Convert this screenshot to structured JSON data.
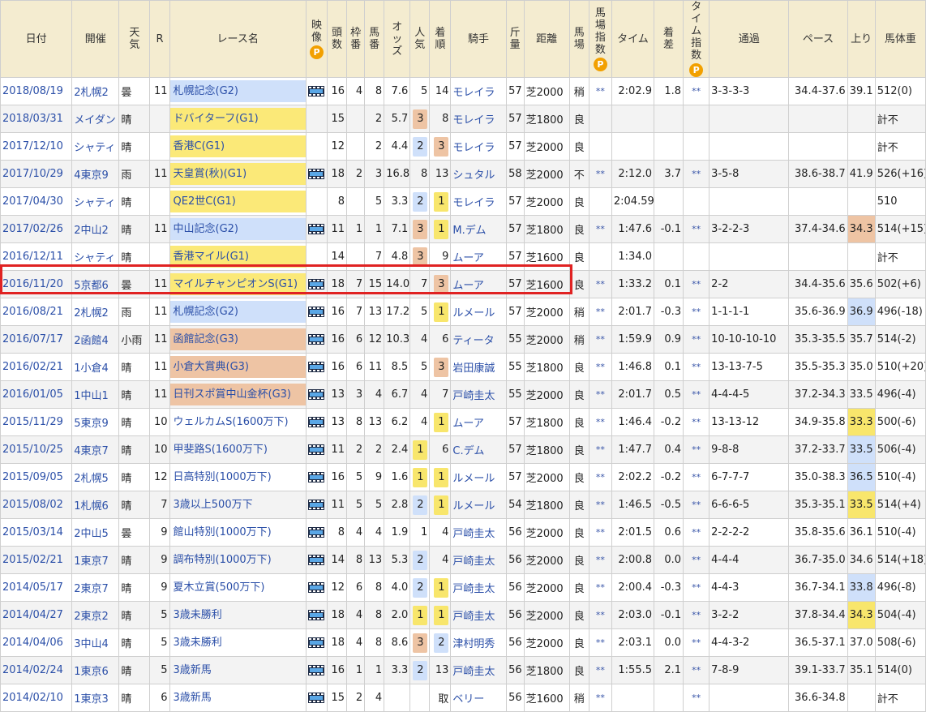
{
  "headers": {
    "date": "日付",
    "venue": "開催",
    "weather": [
      "天",
      "気"
    ],
    "race_no": "R",
    "race_name": "レース名",
    "video": [
      "映",
      "像"
    ],
    "field_size": [
      "頭",
      "数"
    ],
    "frame": [
      "枠",
      "番"
    ],
    "horse_no": [
      "馬",
      "番"
    ],
    "odds": [
      "オ",
      "ッ",
      "ズ"
    ],
    "popularity": [
      "人",
      "気"
    ],
    "finish": [
      "着",
      "順"
    ],
    "jockey": "騎手",
    "weight_carried": [
      "斤",
      "量"
    ],
    "distance": "距離",
    "track": [
      "馬",
      "場"
    ],
    "track_index": [
      "馬",
      "場",
      "指",
      "数"
    ],
    "time": "タイム",
    "margin": [
      "着",
      "差"
    ],
    "time_index": [
      "タ",
      "イ",
      "ム",
      "指",
      "数"
    ],
    "passing": "通過",
    "pace": "ペース",
    "last3f": "上り",
    "body_weight": "馬体重",
    "p_badge": "P"
  },
  "rows": [
    {
      "date": "2018/08/19",
      "venue": "2札幌2",
      "weather": "曇",
      "race_no": "11",
      "race_name": "札幌記念(G2)",
      "grade": "g2",
      "video": true,
      "field_size": "16",
      "frame": "4",
      "horse_no": "8",
      "odds": "7.6",
      "popularity": "5",
      "finish": "14",
      "finish_mark": "",
      "jockey": "モレイラ",
      "weight_carried": "57",
      "distance": "芝2000",
      "track": "稍",
      "track_index": "**",
      "time": "2:02.9",
      "margin": "1.8",
      "time_index": "**",
      "passing": "3-3-3-3",
      "pace": "34.4-37.6",
      "last3f": "39.1",
      "last3f_rank": "",
      "body_weight": "512(0)"
    },
    {
      "date": "2018/03/31",
      "venue": "メイダン",
      "weather": "晴",
      "race_no": "",
      "race_name": "ドバイターフ(G1)",
      "grade": "g1",
      "video": false,
      "field_size": "15",
      "frame": "",
      "horse_no": "2",
      "odds": "5.7",
      "popularity": "3",
      "finish": "8",
      "finish_mark": "",
      "jockey": "モレイラ",
      "weight_carried": "57",
      "distance": "芝1800",
      "track": "良",
      "track_index": "",
      "time": "",
      "margin": "",
      "time_index": "",
      "passing": "",
      "pace": "",
      "last3f": "",
      "last3f_rank": "",
      "body_weight": "計不",
      "pop_mark": "p"
    },
    {
      "date": "2017/12/10",
      "venue": "シャティ",
      "weather": "晴",
      "race_no": "",
      "race_name": "香港C(G1)",
      "grade": "g1",
      "video": false,
      "field_size": "12",
      "frame": "",
      "horse_no": "2",
      "odds": "4.4",
      "popularity": "2",
      "finish": "3",
      "finish_mark": "p",
      "jockey": "モレイラ",
      "weight_carried": "57",
      "distance": "芝2000",
      "track": "良",
      "track_index": "",
      "time": "",
      "margin": "",
      "time_index": "",
      "passing": "",
      "pace": "",
      "last3f": "",
      "last3f_rank": "",
      "body_weight": "計不",
      "pop_mark": "b"
    },
    {
      "date": "2017/10/29",
      "venue": "4東京9",
      "weather": "雨",
      "race_no": "11",
      "race_name": "天皇賞(秋)(G1)",
      "grade": "g1",
      "video": true,
      "field_size": "18",
      "frame": "2",
      "horse_no": "3",
      "odds": "16.8",
      "popularity": "8",
      "finish": "13",
      "finish_mark": "",
      "jockey": "シュタル",
      "weight_carried": "58",
      "distance": "芝2000",
      "track": "不",
      "track_index": "**",
      "time": "2:12.0",
      "margin": "3.7",
      "time_index": "**",
      "passing": "3-5-8",
      "pace": "38.6-38.7",
      "last3f": "41.9",
      "last3f_rank": "",
      "body_weight": "526(+16)"
    },
    {
      "date": "2017/04/30",
      "venue": "シャティ",
      "weather": "晴",
      "race_no": "",
      "race_name": "QE2世C(G1)",
      "grade": "g1",
      "video": false,
      "field_size": "8",
      "frame": "",
      "horse_no": "5",
      "odds": "3.3",
      "popularity": "2",
      "finish": "1",
      "finish_mark": "w",
      "jockey": "モレイラ",
      "weight_carried": "57",
      "distance": "芝2000",
      "track": "良",
      "track_index": "",
      "time": "2:04.59",
      "margin": "",
      "time_index": "",
      "passing": "",
      "pace": "",
      "last3f": "",
      "last3f_rank": "",
      "body_weight": "510",
      "pop_mark": "b"
    },
    {
      "date": "2017/02/26",
      "venue": "2中山2",
      "weather": "晴",
      "race_no": "11",
      "race_name": "中山記念(G2)",
      "grade": "g2",
      "video": true,
      "field_size": "11",
      "frame": "1",
      "horse_no": "1",
      "odds": "7.1",
      "popularity": "3",
      "finish": "1",
      "finish_mark": "w",
      "jockey": "M.デム",
      "weight_carried": "57",
      "distance": "芝1800",
      "track": "良",
      "track_index": "**",
      "time": "1:47.6",
      "margin": "-0.1",
      "time_index": "**",
      "passing": "3-2-2-3",
      "pace": "37.4-34.6",
      "last3f": "34.3",
      "last3f_rank": "fast2",
      "body_weight": "514(+15)",
      "pop_mark": "p"
    },
    {
      "date": "2016/12/11",
      "venue": "シャティ",
      "weather": "晴",
      "race_no": "",
      "race_name": "香港マイル(G1)",
      "grade": "g1",
      "video": false,
      "field_size": "14",
      "frame": "",
      "horse_no": "7",
      "odds": "4.8",
      "popularity": "3",
      "finish": "9",
      "finish_mark": "",
      "jockey": "ムーア",
      "weight_carried": "57",
      "distance": "芝1600",
      "track": "良",
      "track_index": "",
      "time": "1:34.0",
      "margin": "",
      "time_index": "",
      "passing": "",
      "pace": "",
      "last3f": "",
      "last3f_rank": "",
      "body_weight": "計不",
      "pop_mark": "p"
    },
    {
      "date": "2016/11/20",
      "venue": "5京都6",
      "weather": "曇",
      "race_no": "11",
      "race_name": "マイルチャンピオンS(G1)",
      "grade": "g1",
      "video": true,
      "field_size": "18",
      "frame": "7",
      "horse_no": "15",
      "odds": "14.0",
      "popularity": "7",
      "finish": "3",
      "finish_mark": "p",
      "jockey": "ムーア",
      "weight_carried": "57",
      "distance": "芝1600",
      "track": "良",
      "track_index": "**",
      "time": "1:33.2",
      "margin": "0.1",
      "time_index": "**",
      "passing": "2-2",
      "pace": "34.4-35.6",
      "last3f": "35.6",
      "last3f_rank": "",
      "body_weight": "502(+6)"
    },
    {
      "date": "2016/08/21",
      "venue": "2札幌2",
      "weather": "雨",
      "race_no": "11",
      "race_name": "札幌記念(G2)",
      "grade": "g2",
      "video": true,
      "field_size": "16",
      "frame": "7",
      "horse_no": "13",
      "odds": "17.2",
      "popularity": "5",
      "finish": "1",
      "finish_mark": "w",
      "jockey": "ルメール",
      "weight_carried": "57",
      "distance": "芝2000",
      "track": "稍",
      "track_index": "**",
      "time": "2:01.7",
      "margin": "-0.3",
      "time_index": "**",
      "passing": "1-1-1-1",
      "pace": "35.6-36.9",
      "last3f": "36.9",
      "last3f_rank": "fast3",
      "body_weight": "496(-18)"
    },
    {
      "date": "2016/07/17",
      "venue": "2函館4",
      "weather": "小雨",
      "race_no": "11",
      "race_name": "函館記念(G3)",
      "grade": "g3",
      "video": true,
      "field_size": "16",
      "frame": "6",
      "horse_no": "12",
      "odds": "10.3",
      "popularity": "4",
      "finish": "6",
      "finish_mark": "",
      "jockey": "ティータ",
      "weight_carried": "55",
      "distance": "芝2000",
      "track": "稍",
      "track_index": "**",
      "time": "1:59.9",
      "margin": "0.9",
      "time_index": "**",
      "passing": "10-10-10-10",
      "pace": "35.3-35.5",
      "last3f": "35.7",
      "last3f_rank": "",
      "body_weight": "514(-2)"
    },
    {
      "date": "2016/02/21",
      "venue": "1小倉4",
      "weather": "晴",
      "race_no": "11",
      "race_name": "小倉大賞典(G3)",
      "grade": "g3",
      "video": true,
      "field_size": "16",
      "frame": "6",
      "horse_no": "11",
      "odds": "8.5",
      "popularity": "5",
      "finish": "3",
      "finish_mark": "p",
      "jockey": "岩田康誠",
      "weight_carried": "55",
      "distance": "芝1800",
      "track": "良",
      "track_index": "**",
      "time": "1:46.8",
      "margin": "0.1",
      "time_index": "**",
      "passing": "13-13-7-5",
      "pace": "35.5-35.3",
      "last3f": "35.0",
      "last3f_rank": "",
      "body_weight": "510(+20)"
    },
    {
      "date": "2016/01/05",
      "venue": "1中山1",
      "weather": "晴",
      "race_no": "11",
      "race_name": "日刊スポ賞中山金杯(G3)",
      "grade": "g3",
      "video": true,
      "field_size": "13",
      "frame": "3",
      "horse_no": "4",
      "odds": "6.7",
      "popularity": "4",
      "finish": "7",
      "finish_mark": "",
      "jockey": "戸崎圭太",
      "weight_carried": "55",
      "distance": "芝2000",
      "track": "良",
      "track_index": "**",
      "time": "2:01.7",
      "margin": "0.5",
      "time_index": "**",
      "passing": "4-4-4-5",
      "pace": "37.2-34.3",
      "last3f": "33.5",
      "last3f_rank": "",
      "body_weight": "496(-4)"
    },
    {
      "date": "2015/11/29",
      "venue": "5東京9",
      "weather": "晴",
      "race_no": "10",
      "race_name": "ウェルカムS(1600万下)",
      "grade": "",
      "video": true,
      "field_size": "13",
      "frame": "8",
      "horse_no": "13",
      "odds": "6.2",
      "popularity": "4",
      "finish": "1",
      "finish_mark": "w",
      "jockey": "ムーア",
      "weight_carried": "57",
      "distance": "芝1800",
      "track": "良",
      "track_index": "**",
      "time": "1:46.4",
      "margin": "-0.2",
      "time_index": "**",
      "passing": "13-13-12",
      "pace": "34.9-35.8",
      "last3f": "33.3",
      "last3f_rank": "fast1",
      "body_weight": "500(-6)"
    },
    {
      "date": "2015/10/25",
      "venue": "4東京7",
      "weather": "晴",
      "race_no": "10",
      "race_name": "甲斐路S(1600万下)",
      "grade": "",
      "video": true,
      "field_size": "11",
      "frame": "2",
      "horse_no": "2",
      "odds": "2.4",
      "popularity": "1",
      "finish": "6",
      "finish_mark": "",
      "jockey": "C.デム",
      "weight_carried": "57",
      "distance": "芝1800",
      "track": "良",
      "track_index": "**",
      "time": "1:47.7",
      "margin": "0.4",
      "time_index": "**",
      "passing": "9-8-8",
      "pace": "37.2-33.7",
      "last3f": "33.5",
      "last3f_rank": "fast3",
      "body_weight": "506(-4)",
      "pop_mark": "w"
    },
    {
      "date": "2015/09/05",
      "venue": "2札幌5",
      "weather": "晴",
      "race_no": "12",
      "race_name": "日高特別(1000万下)",
      "grade": "",
      "video": true,
      "field_size": "16",
      "frame": "5",
      "horse_no": "9",
      "odds": "1.6",
      "popularity": "1",
      "finish": "1",
      "finish_mark": "w",
      "jockey": "ルメール",
      "weight_carried": "57",
      "distance": "芝2000",
      "track": "良",
      "track_index": "**",
      "time": "2:02.2",
      "margin": "-0.2",
      "time_index": "**",
      "passing": "6-7-7-7",
      "pace": "35.0-38.3",
      "last3f": "36.5",
      "last3f_rank": "fast3",
      "body_weight": "510(-4)",
      "pop_mark": "w"
    },
    {
      "date": "2015/08/02",
      "venue": "1札幌6",
      "weather": "晴",
      "race_no": "7",
      "race_name": "3歳以上500万下",
      "grade": "",
      "video": true,
      "field_size": "11",
      "frame": "5",
      "horse_no": "5",
      "odds": "2.8",
      "popularity": "2",
      "finish": "1",
      "finish_mark": "w",
      "jockey": "ルメール",
      "weight_carried": "54",
      "distance": "芝1800",
      "track": "良",
      "track_index": "**",
      "time": "1:46.5",
      "margin": "-0.5",
      "time_index": "**",
      "passing": "6-6-6-5",
      "pace": "35.3-35.1",
      "last3f": "33.5",
      "last3f_rank": "fast1",
      "body_weight": "514(+4)",
      "pop_mark": "b"
    },
    {
      "date": "2015/03/14",
      "venue": "2中山5",
      "weather": "曇",
      "race_no": "9",
      "race_name": "館山特別(1000万下)",
      "grade": "",
      "video": true,
      "field_size": "8",
      "frame": "4",
      "horse_no": "4",
      "odds": "1.9",
      "popularity": "1",
      "finish": "4",
      "finish_mark": "",
      "jockey": "戸崎圭太",
      "weight_carried": "56",
      "distance": "芝2000",
      "track": "良",
      "track_index": "**",
      "time": "2:01.5",
      "margin": "0.6",
      "time_index": "**",
      "passing": "2-2-2-2",
      "pace": "35.8-35.6",
      "last3f": "36.1",
      "last3f_rank": "",
      "body_weight": "510(-4)"
    },
    {
      "date": "2015/02/21",
      "venue": "1東京7",
      "weather": "晴",
      "race_no": "9",
      "race_name": "調布特別(1000万下)",
      "grade": "",
      "video": true,
      "field_size": "14",
      "frame": "8",
      "horse_no": "13",
      "odds": "5.3",
      "popularity": "2",
      "finish": "4",
      "finish_mark": "",
      "jockey": "戸崎圭太",
      "weight_carried": "56",
      "distance": "芝2000",
      "track": "良",
      "track_index": "**",
      "time": "2:00.8",
      "margin": "0.0",
      "time_index": "**",
      "passing": "4-4-4",
      "pace": "36.7-35.0",
      "last3f": "34.6",
      "last3f_rank": "",
      "body_weight": "514(+18)",
      "pop_mark": "b"
    },
    {
      "date": "2014/05/17",
      "venue": "2東京7",
      "weather": "晴",
      "race_no": "9",
      "race_name": "夏木立賞(500万下)",
      "grade": "",
      "video": true,
      "field_size": "12",
      "frame": "6",
      "horse_no": "8",
      "odds": "4.0",
      "popularity": "2",
      "finish": "1",
      "finish_mark": "w",
      "jockey": "戸崎圭太",
      "weight_carried": "56",
      "distance": "芝2000",
      "track": "良",
      "track_index": "**",
      "time": "2:00.4",
      "margin": "-0.3",
      "time_index": "**",
      "passing": "4-4-3",
      "pace": "36.7-34.1",
      "last3f": "33.8",
      "last3f_rank": "fast3",
      "body_weight": "496(-8)",
      "pop_mark": "b"
    },
    {
      "date": "2014/04/27",
      "venue": "2東京2",
      "weather": "晴",
      "race_no": "5",
      "race_name": "3歳未勝利",
      "grade": "",
      "video": true,
      "field_size": "18",
      "frame": "4",
      "horse_no": "8",
      "odds": "2.0",
      "popularity": "1",
      "finish": "1",
      "finish_mark": "w",
      "jockey": "戸崎圭太",
      "weight_carried": "56",
      "distance": "芝2000",
      "track": "良",
      "track_index": "**",
      "time": "2:03.0",
      "margin": "-0.1",
      "time_index": "**",
      "passing": "3-2-2",
      "pace": "37.8-34.4",
      "last3f": "34.3",
      "last3f_rank": "fast1",
      "body_weight": "504(-4)",
      "pop_mark": "w"
    },
    {
      "date": "2014/04/06",
      "venue": "3中山4",
      "weather": "晴",
      "race_no": "5",
      "race_name": "3歳未勝利",
      "grade": "",
      "video": true,
      "field_size": "18",
      "frame": "4",
      "horse_no": "8",
      "odds": "8.6",
      "popularity": "3",
      "finish": "2",
      "finish_mark": "b",
      "jockey": "津村明秀",
      "weight_carried": "56",
      "distance": "芝2000",
      "track": "良",
      "track_index": "**",
      "time": "2:03.1",
      "margin": "0.0",
      "time_index": "**",
      "passing": "4-4-3-2",
      "pace": "36.5-37.1",
      "last3f": "37.0",
      "last3f_rank": "",
      "body_weight": "508(-6)",
      "pop_mark": "p"
    },
    {
      "date": "2014/02/24",
      "venue": "1東京6",
      "weather": "晴",
      "race_no": "5",
      "race_name": "3歳新馬",
      "grade": "",
      "video": true,
      "field_size": "16",
      "frame": "1",
      "horse_no": "1",
      "odds": "3.3",
      "popularity": "2",
      "finish": "13",
      "finish_mark": "",
      "jockey": "戸崎圭太",
      "weight_carried": "56",
      "distance": "芝1800",
      "track": "良",
      "track_index": "**",
      "time": "1:55.5",
      "margin": "2.1",
      "time_index": "**",
      "passing": "7-8-9",
      "pace": "39.1-33.7",
      "last3f": "35.1",
      "last3f_rank": "",
      "body_weight": "514(0)",
      "pop_mark": "b"
    },
    {
      "date": "2014/02/10",
      "venue": "1東京3",
      "weather": "晴",
      "race_no": "6",
      "race_name": "3歳新馬",
      "grade": "",
      "video": true,
      "field_size": "15",
      "frame": "2",
      "horse_no": "4",
      "odds": "",
      "popularity": "",
      "finish": "取",
      "finish_mark": "",
      "jockey": "ベリー",
      "weight_carried": "56",
      "distance": "芝1600",
      "track": "稍",
      "track_index": "**",
      "time": "",
      "margin": "",
      "time_index": "**",
      "passing": "",
      "pace": "36.6-34.8",
      "last3f": "",
      "last3f_rank": "",
      "body_weight": "計不"
    }
  ],
  "highlight_row_date": "2016/11/20",
  "colors": {
    "header_bg": "#f4ecd0",
    "link": "#2b4fa8",
    "g1": "#fbe978",
    "g2": "#cfe0fa",
    "g3": "#eec4a4",
    "highlight_border": "#e02222",
    "p_badge": "#f2a000"
  }
}
